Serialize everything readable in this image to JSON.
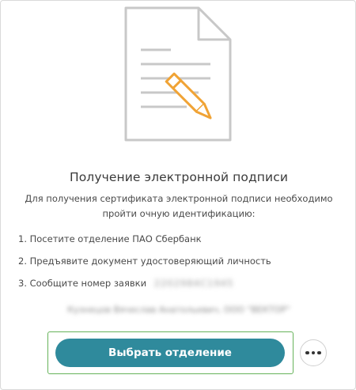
{
  "card": {
    "title": "Получение электронной подписи",
    "subtitle": "Для получения сертификата электронной подписи необходимо пройти очную идентификацию:",
    "steps": [
      {
        "text": "1. Посетите отделение ПАО Сбербанк"
      },
      {
        "text": "2. Предъявите документ удостоверяющий личность"
      },
      {
        "text": "3. Сообщите номер заявки",
        "value": "2202984C1945"
      }
    ],
    "blurred_line": "Кузнецов Вячеслав Анатольевич, ООО \"ВЕКТОР\"",
    "primary_button": "Выбрать отделение",
    "more_button_icon": "more-dots-icon"
  },
  "colors": {
    "accent": "#2f8a9c",
    "illustration_orange": "#f0a335",
    "illustration_gray": "#c8c8c8",
    "focus_frame": "#66b35a"
  }
}
